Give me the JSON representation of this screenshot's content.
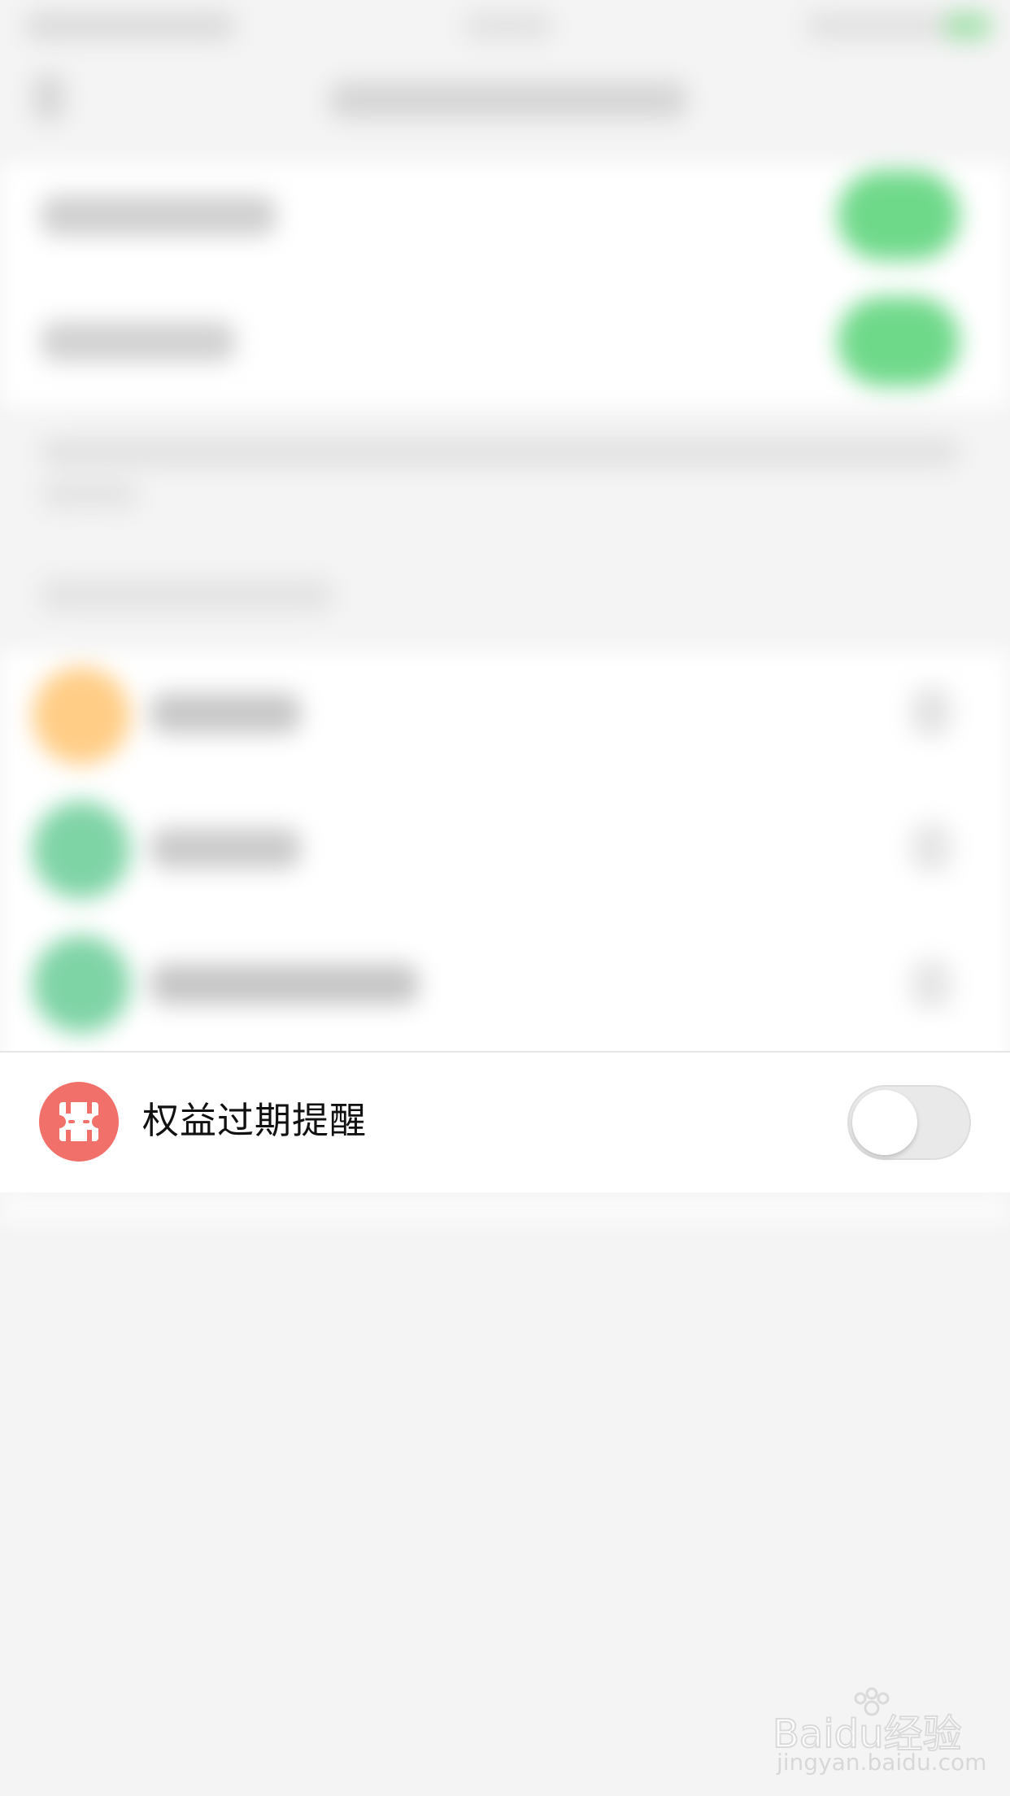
{
  "row": {
    "label": "权益过期提醒",
    "toggle_on": false
  },
  "colors": {
    "icon_bg": "#f2706a",
    "toggle_off_bg": "#e9e9ea",
    "blurred_toggle_on": "#6fd98a",
    "page_bg": "#f4f4f4"
  },
  "icons": {
    "row_icon": "benefit-ticket-icon"
  },
  "watermark": {
    "logo_text": "Baidu经验",
    "url": "jingyan.baidu.com"
  }
}
